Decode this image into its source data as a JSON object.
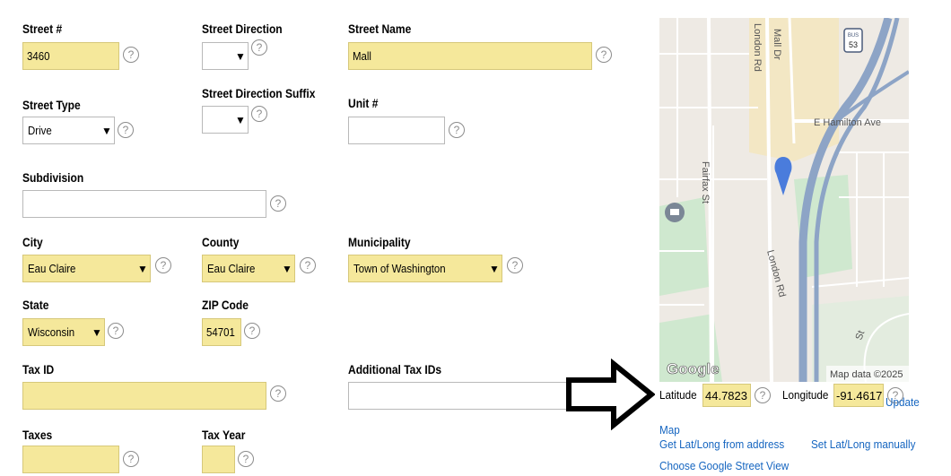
{
  "form": {
    "street_number": {
      "label": "Street #",
      "value": "3460"
    },
    "street_direction": {
      "label": "Street Direction",
      "value": ""
    },
    "street_name": {
      "label": "Street Name",
      "value": "Mall"
    },
    "street_type": {
      "label": "Street Type",
      "value": "Drive"
    },
    "street_direction_suffix": {
      "label": "Street Direction Suffix",
      "value": ""
    },
    "unit": {
      "label": "Unit #",
      "value": ""
    },
    "subdivision": {
      "label": "Subdivision",
      "value": ""
    },
    "city": {
      "label": "City",
      "value": "Eau Claire"
    },
    "county": {
      "label": "County",
      "value": "Eau Claire"
    },
    "municipality": {
      "label": "Municipality",
      "value": "Town of Washington"
    },
    "state": {
      "label": "State",
      "value": "Wisconsin"
    },
    "zip": {
      "label": "ZIP Code",
      "value": "54701"
    },
    "tax_id": {
      "label": "Tax ID",
      "value": ""
    },
    "additional_tax_ids": {
      "label": "Additional Tax IDs",
      "value": ""
    },
    "taxes": {
      "label": "Taxes",
      "value": ""
    },
    "tax_year": {
      "label": "Tax Year",
      "value": ""
    },
    "help_glyph": "?",
    "chevron_glyph": "⌄"
  },
  "map": {
    "road_labels": {
      "london_rd_top": "London Rd",
      "mall_dr": "Mall Dr",
      "e_hamilton_ave": "E Hamilton Ave",
      "fairfax_st": "Fairfax St",
      "london_rd_bottom": "London Rd",
      "side_street": "St"
    },
    "highway_shield": {
      "top": "BUS",
      "number": "53"
    },
    "google_logo": "Google",
    "attribution": "Map data ©2025",
    "colors": {
      "highway": "#8da4c6",
      "park": "#cfe8cf",
      "commercial": "#f3e7c4",
      "pin": "#4a7cdc"
    }
  },
  "coords": {
    "latitude_label": "Latitude",
    "latitude_value": "44.7823",
    "longitude_label": "Longitude",
    "longitude_value": "-91.4617",
    "update_map_link": "Update Map",
    "get_latlong_link": "Get Lat/Long from address",
    "set_latlong_link": "Set Lat/Long manually",
    "street_view_link": "Choose Google Street View"
  }
}
